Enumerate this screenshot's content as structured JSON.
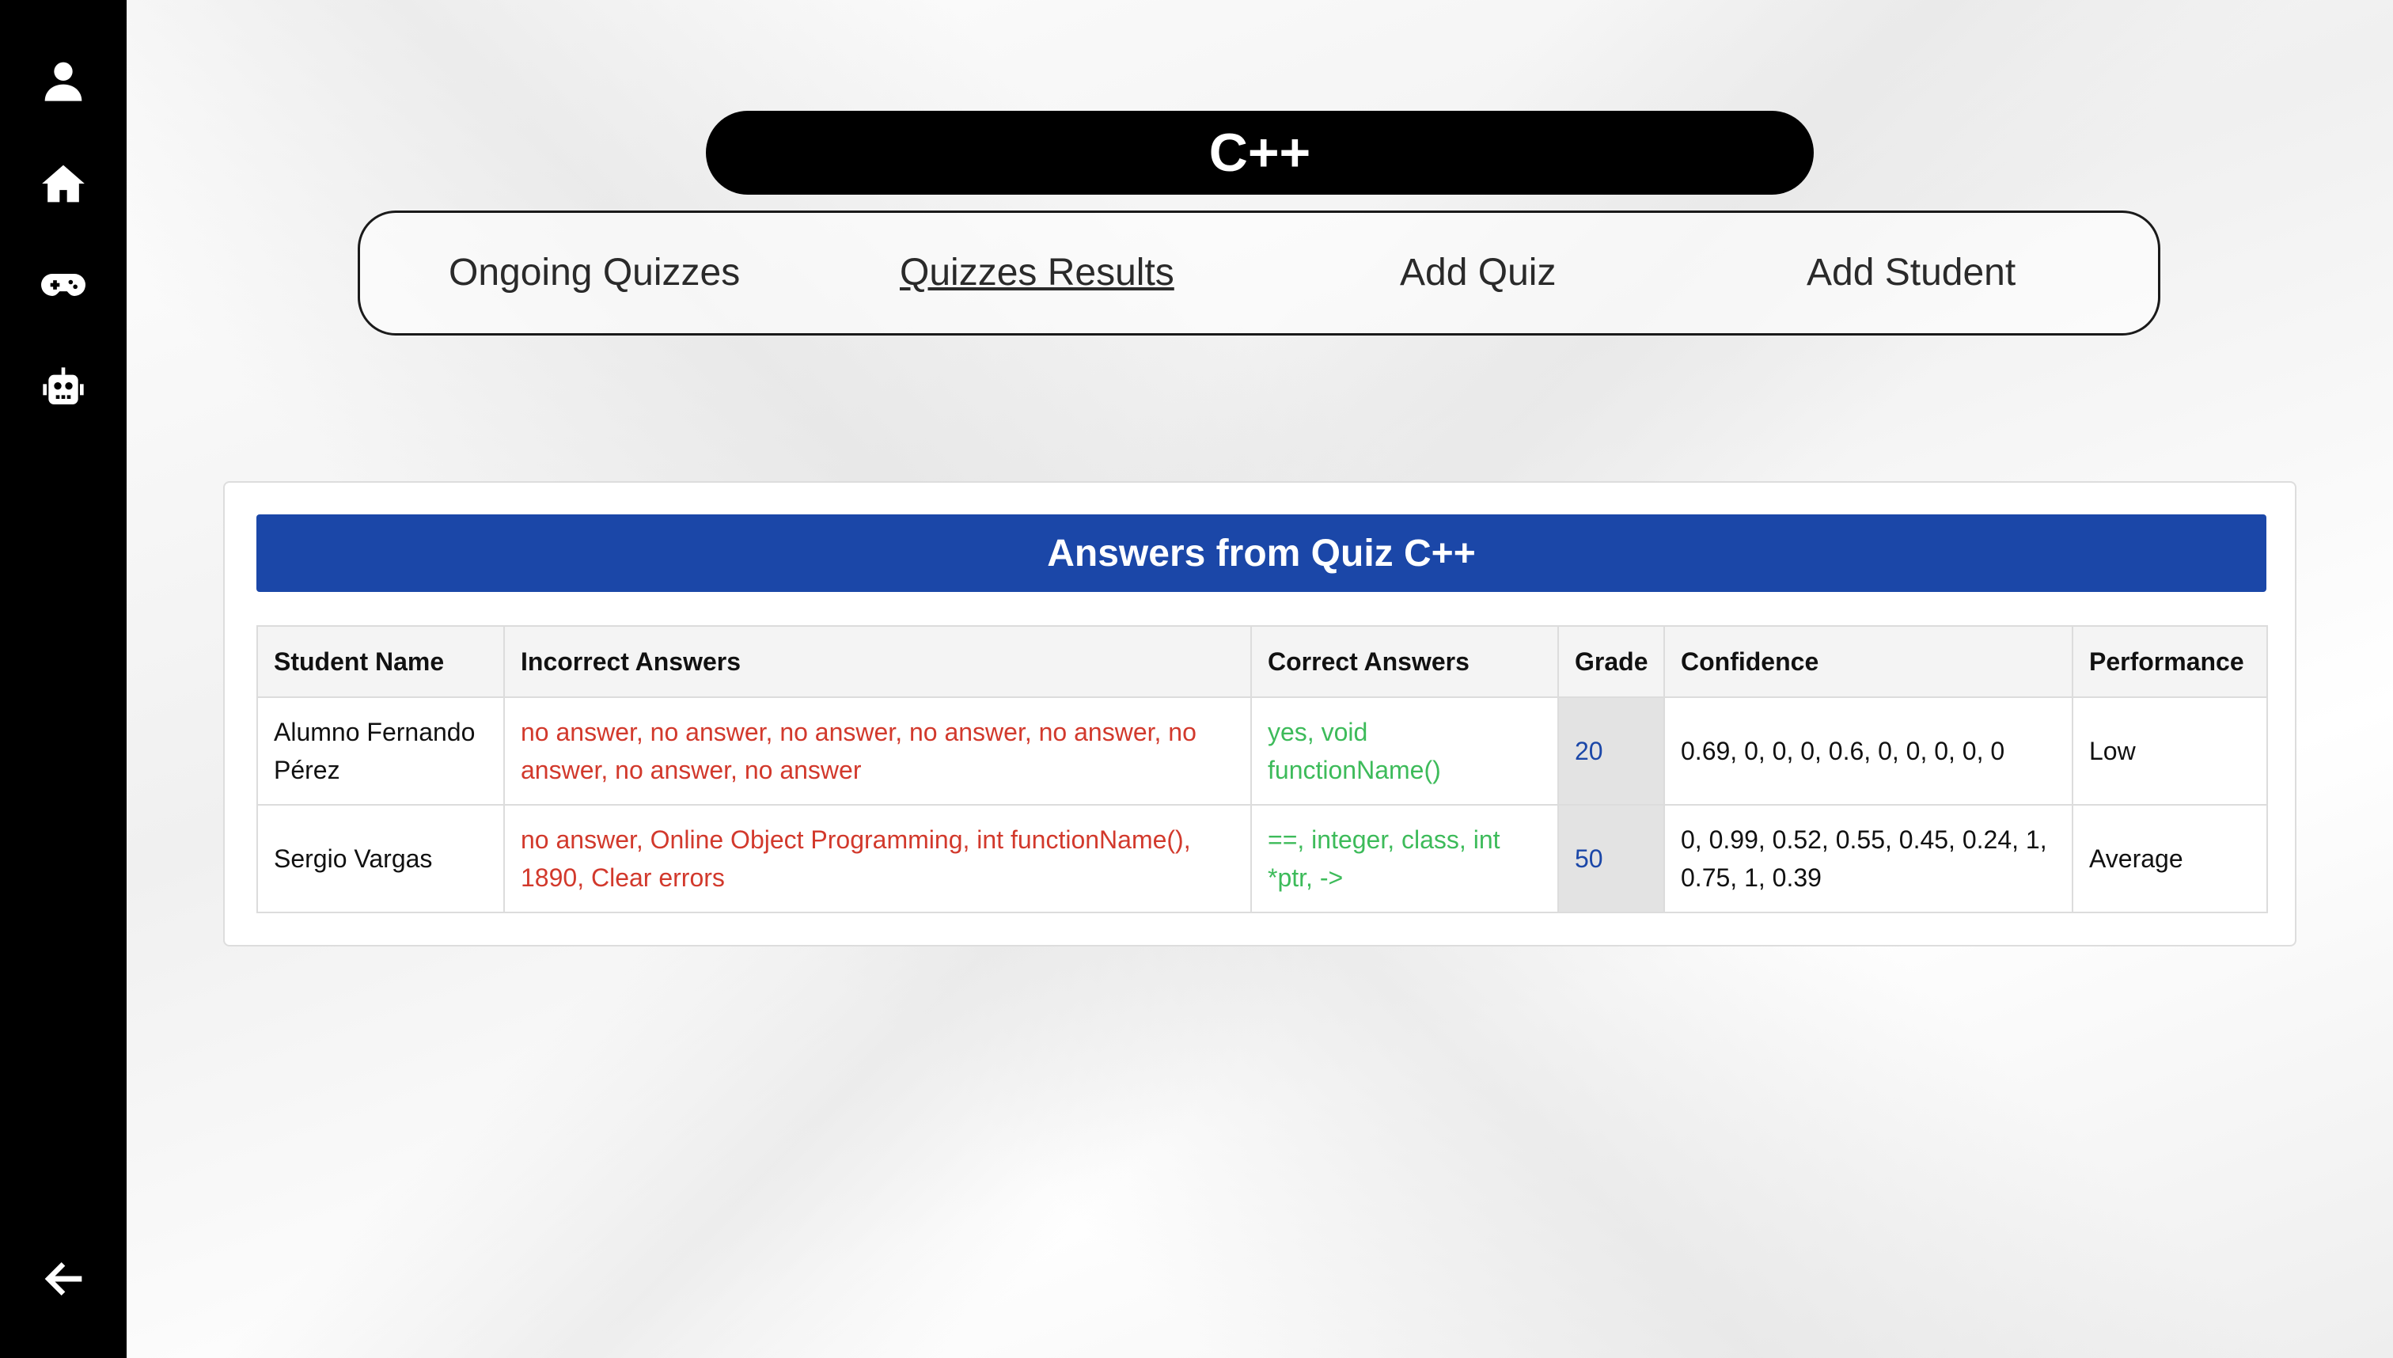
{
  "sidebar": {
    "items": [
      {
        "icon": "user-icon"
      },
      {
        "icon": "home-icon"
      },
      {
        "icon": "gamepad-icon"
      },
      {
        "icon": "robot-icon"
      }
    ],
    "back_icon": "arrow-left-icon"
  },
  "course_title": "C++",
  "nav": {
    "ongoing": "Ongoing Quizzes",
    "results": "Quizzes Results",
    "add_quiz": "Add Quiz",
    "add_student": "Add Student",
    "active": "Quizzes Results"
  },
  "card": {
    "title": "Answers from Quiz C++",
    "header_color": "#1b47a8",
    "columns": [
      "Student Name",
      "Incorrect Answers",
      "Correct Answers",
      "Grade",
      "Confidence",
      "Performance"
    ],
    "rows": [
      {
        "name": "Alumno Fernando Pérez",
        "incorrect": "no answer, no answer, no answer, no answer, no answer, no answer, no answer, no answer",
        "correct": "yes, void functionName()",
        "grade": "20",
        "confidence": "0.69, 0, 0, 0, 0.6, 0, 0, 0, 0, 0",
        "performance": "Low"
      },
      {
        "name": "Sergio Vargas",
        "incorrect": "no answer, Online Object Programming, int functionName(), 1890, Clear errors",
        "correct": "==, integer, class, int *ptr, ->",
        "grade": "50",
        "confidence": "0, 0.99, 0.52, 0.55, 0.45, 0.24, 1, 0.75, 1, 0.39",
        "performance": "Average"
      }
    ]
  },
  "colors": {
    "incorrect": "#d2392c",
    "correct": "#3dbb5a",
    "grade": "#1b47a8"
  }
}
